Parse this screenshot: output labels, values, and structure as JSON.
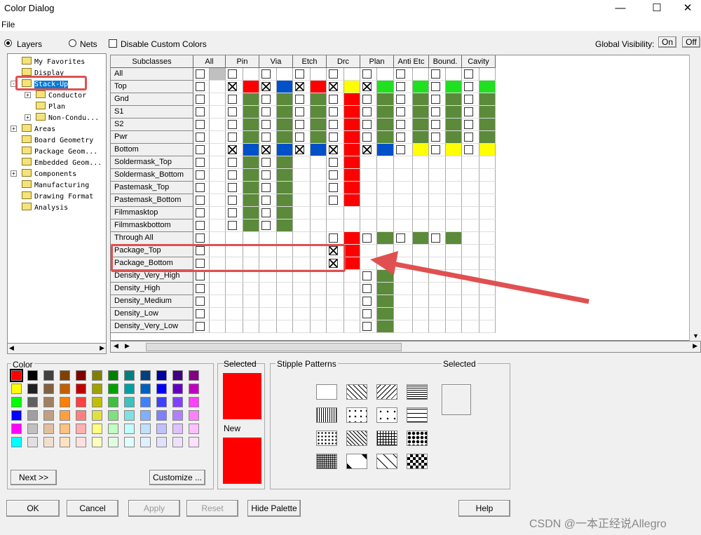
{
  "window": {
    "title": "Color Dialog",
    "minimize": "—",
    "maximize": "☐",
    "close": "✕"
  },
  "menu": {
    "file": "File"
  },
  "toolbar": {
    "layers": "Layers",
    "nets": "Nets",
    "disable_custom": "Disable Custom Colors",
    "global_visibility": "Global Visibility:",
    "on": "On",
    "off": "Off"
  },
  "tree": [
    {
      "label": "My Favorites",
      "exp": ""
    },
    {
      "label": "Display",
      "exp": ""
    },
    {
      "label": "Stack-Up",
      "exp": "-"
    },
    {
      "label": "Conductor",
      "exp": "+"
    },
    {
      "label": "Plan",
      "exp": ""
    },
    {
      "label": "Non-Condu...",
      "exp": "+"
    },
    {
      "label": "Areas",
      "exp": "+"
    },
    {
      "label": "Board Geometry",
      "exp": ""
    },
    {
      "label": "Package Geom...",
      "exp": ""
    },
    {
      "label": "Embedded Geom...",
      "exp": ""
    },
    {
      "label": "Components",
      "exp": "+"
    },
    {
      "label": "Manufacturing",
      "exp": ""
    },
    {
      "label": "Drawing Format",
      "exp": ""
    },
    {
      "label": "Analysis",
      "exp": ""
    }
  ],
  "grid": {
    "subclasses_header": "Subclasses",
    "columns": [
      "All",
      "Pin",
      "Via",
      "Etch",
      "Drc",
      "Plan",
      "Anti Etc",
      "Bound.",
      "Cavity"
    ],
    "rows": [
      "All",
      "Top",
      "Gnd",
      "S1",
      "S2",
      "Pwr",
      "Bottom",
      "Soldermask_Top",
      "Soldermask_Bottom",
      "Pastemask_Top",
      "Pastemask_Bottom",
      "Filmmasktop",
      "Filmmaskbottom",
      "Through All",
      "Package_Top",
      "Package_Bottom",
      "Density_Very_High",
      "Density_High",
      "Density_Medium",
      "Density_Low",
      "Density_Very_Low"
    ]
  },
  "color_panel": {
    "label": "Color",
    "next": "Next >>",
    "customize": "Customize ..."
  },
  "selected_panel": {
    "selected": "Selected",
    "new": "New",
    "selected_color": "#ff0000",
    "new_color": "#ff0000"
  },
  "stipple": {
    "label": "Stipple Patterns",
    "selected": "Selected"
  },
  "buttons": {
    "ok": "OK",
    "cancel": "Cancel",
    "apply": "Apply",
    "reset": "Reset",
    "hide_palette": "Hide Palette",
    "help": "Help"
  },
  "watermark": "CSDN @一本正经说Allegro",
  "colors": {
    "red": "#ff0000",
    "green": "#5b8a3a",
    "blue": "#0050c8",
    "yellow": "#ffff00",
    "lime": "#20e020",
    "gray": "#c0c0c0",
    "highlight": "#0078d7"
  }
}
